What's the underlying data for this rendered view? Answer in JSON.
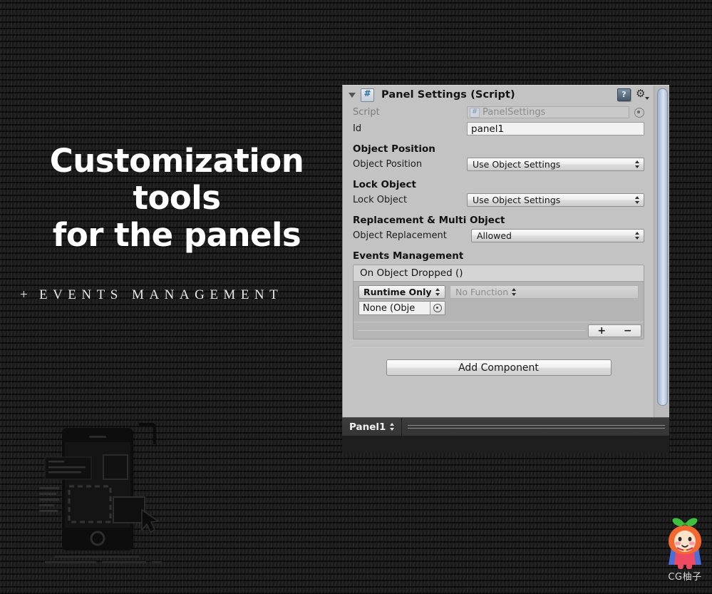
{
  "promo": {
    "headline_line1": "Customization tools",
    "headline_line2": "for the panels",
    "subtitle_plus": "+",
    "subtitle": "EVENTS MANAGEMENT"
  },
  "watermark": {
    "caption": "CG柚子",
    "mascot_icon": "pomelo-mascot-icon"
  },
  "illustration": {
    "name": "phone-drag-drop-illustration"
  },
  "inspector": {
    "component": {
      "title": "Panel Settings (Script)",
      "script_icon": "csharp-script-icon",
      "foldout_icon": "foldout-open-icon",
      "help_icon": "help-book-icon",
      "gear_icon": "gear-icon"
    },
    "script_row": {
      "label": "Script",
      "value": "PanelSettings",
      "picker_icon": "object-picker-icon"
    },
    "id_row": {
      "label": "Id",
      "value": "panel1"
    },
    "sections": [
      {
        "heading": "Object Position",
        "row_label": "Object Position",
        "row_value": "Use Object Settings"
      },
      {
        "heading": "Lock Object",
        "row_label": "Lock Object",
        "row_value": "Use Object Settings"
      },
      {
        "heading": "Replacement & Multi Object",
        "row_label": "Object Replacement",
        "row_value": "Allowed"
      }
    ],
    "events": {
      "heading": "Events Management",
      "event_title": "On Object Dropped ()",
      "entry": {
        "mode": "Runtime Only",
        "function": "No Function",
        "target": "None (Obje"
      },
      "add_label": "+",
      "remove_label": "−"
    },
    "add_component_label": "Add Component",
    "scrollbar": {
      "name": "vertical-scrollbar",
      "down_arrow_icon": "chevron-down-icon"
    }
  },
  "footer": {
    "breadcrumb": "Panel1"
  },
  "colors": {
    "background": "#1a1a1a",
    "panel_bg": "#c3c3c3",
    "scrollbar_thumb": "#c3d2e4",
    "mascot_orange": "#f3682f",
    "mascot_body": "#ef4a63",
    "mascot_cape": "#4a6fd8",
    "mascot_leaf": "#3fbf3f"
  }
}
